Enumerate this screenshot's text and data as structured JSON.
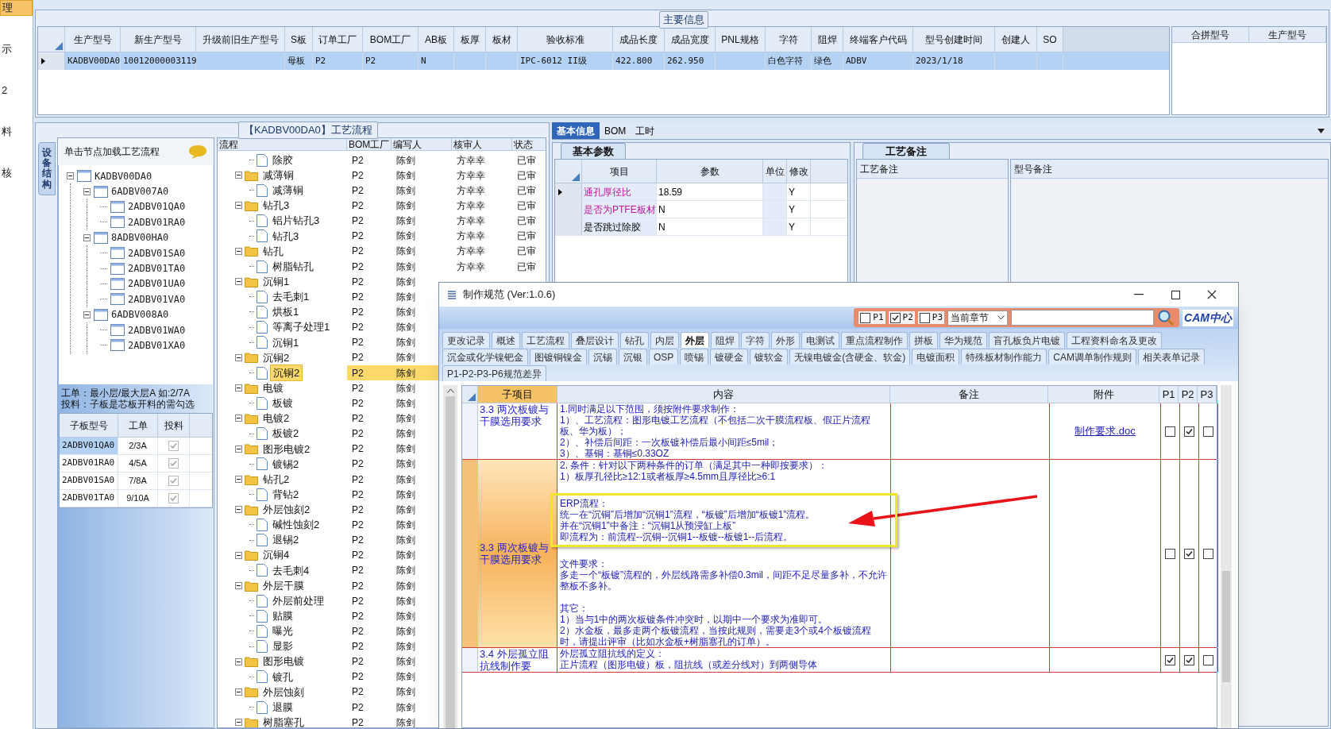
{
  "sidebar": {
    "items": [
      {
        "label": "理",
        "selected": true
      },
      {
        "label": "示",
        "selected": false
      },
      {
        "label": "2",
        "selected": false
      },
      {
        "label": "料",
        "selected": false
      },
      {
        "label": "核",
        "selected": false
      }
    ]
  },
  "main_info": {
    "title": "主要信息",
    "columns": [
      "生产型号",
      "新生产型号",
      "升级前旧生产型号",
      "S板",
      "订单工厂",
      "BOM工厂",
      "AB板",
      "板厚",
      "板材",
      "验收标准",
      "成品长度",
      "成品宽度",
      "PNL规格",
      "字符",
      "阻焊",
      "终端客户代码",
      "型号创建时间",
      "创建人",
      "SO"
    ],
    "rows": [
      {
        "selected": true,
        "cells": [
          "KADBV00DA0",
          "10012000003119",
          null,
          "母板",
          "P2",
          "P2",
          "N",
          null,
          null,
          "IPC-6012 II级",
          "422.800",
          "262.950",
          null,
          "白色字符",
          "绿色",
          "ADBV",
          "2023/1/18",
          null,
          null
        ]
      }
    ],
    "merge_columns": [
      "合拼型号",
      "生产型号"
    ]
  },
  "process": {
    "title": "【KADBV00DA0】工艺流程",
    "side_tab": "设备结构",
    "tree_hint": "单击节点加载工艺流程",
    "structure": [
      {
        "label": "KADBV00DA0",
        "expanded": true,
        "children": [
          {
            "label": "6ADBV007A0",
            "expanded": true,
            "children": [
              {
                "label": "2ADBV01QA0"
              },
              {
                "label": "2ADBV01RA0"
              }
            ]
          },
          {
            "label": "8ADBV00HA0",
            "expanded": true,
            "children": [
              {
                "label": "2ADBV01SA0"
              },
              {
                "label": "2ADBV01TA0"
              },
              {
                "label": "2ADBV01UA0"
              },
              {
                "label": "2ADBV01VA0"
              }
            ]
          },
          {
            "label": "6ADBV008A0",
            "expanded": true,
            "children": [
              {
                "label": "2ADBV01WA0"
              },
              {
                "label": "2ADBV01XA0"
              }
            ]
          }
        ]
      }
    ],
    "notes": [
      "工单：最小层/最大层A 如:2/7A",
      "投料：子板是芯板开料的需勾选"
    ],
    "boards": {
      "columns": [
        "子板型号",
        "工单",
        "投料"
      ],
      "rows": [
        {
          "cells": [
            "2ADBV01QA0",
            "2/3A"
          ],
          "feed": true,
          "selected": true
        },
        {
          "cells": [
            "2ADBV01RA0",
            "4/5A"
          ],
          "feed": true,
          "selected": false
        },
        {
          "cells": [
            "2ADBV01SA0",
            "7/8A"
          ],
          "feed": true,
          "selected": false
        },
        {
          "cells": [
            "2ADBV01TA0",
            "9/10A"
          ],
          "feed": true,
          "selected": false
        }
      ]
    },
    "flow": {
      "columns": [
        "流程",
        "BOM工厂",
        "编写人",
        "核审人",
        "状态"
      ],
      "rows": [
        {
          "kind": "file",
          "cells": [
            "除胶",
            "P2",
            "陈剑",
            "方幸幸",
            "已审"
          ],
          "selected": false
        },
        {
          "kind": "folder",
          "expanded": true,
          "cells": [
            "减薄铜",
            "P2",
            "陈剑",
            "方幸幸",
            "已审"
          ],
          "selected": false,
          "children": [
            {
              "kind": "file",
              "cells": [
                "减薄铜",
                "P2",
                "陈剑",
                "方幸幸",
                "已审"
              ],
              "selected": false
            }
          ]
        },
        {
          "kind": "folder",
          "expanded": true,
          "cells": [
            "钻孔3",
            "P2",
            "陈剑",
            "方幸幸",
            "已审"
          ],
          "selected": false,
          "children": [
            {
              "kind": "file",
              "cells": [
                "铝片钻孔3",
                "P2",
                "陈剑",
                "方幸幸",
                "已审"
              ],
              "selected": false
            },
            {
              "kind": "file",
              "cells": [
                "钻孔3",
                "P2",
                "陈剑",
                "方幸幸",
                "已审"
              ],
              "selected": false
            }
          ]
        },
        {
          "kind": "folder",
          "expanded": true,
          "cells": [
            "钻孔",
            "P2",
            "陈剑",
            "方幸幸",
            "已审"
          ],
          "selected": false,
          "children": [
            {
              "kind": "file",
              "cells": [
                "树脂钻孔",
                "P2",
                "陈剑",
                "方幸幸",
                "已审"
              ],
              "selected": false
            }
          ]
        },
        {
          "kind": "folder",
          "expanded": true,
          "cells": [
            "沉铜1",
            "P2",
            "陈剑"
          ],
          "selected": false,
          "children": [
            {
              "kind": "file",
              "cells": [
                "去毛刺1",
                "P2",
                "陈剑"
              ],
              "selected": false
            },
            {
              "kind": "file",
              "cells": [
                "烘板1",
                "P2",
                "陈剑"
              ],
              "selected": false
            },
            {
              "kind": "file",
              "cells": [
                "等离子处理1",
                "P2",
                "陈剑"
              ],
              "selected": false
            },
            {
              "kind": "file",
              "cells": [
                "沉铜1",
                "P2",
                "陈剑"
              ],
              "selected": false
            }
          ]
        },
        {
          "kind": "folder",
          "expanded": true,
          "cells": [
            "沉铜2",
            "P2",
            "陈剑"
          ],
          "selected": false,
          "children": [
            {
              "kind": "file",
              "cells": [
                "沉铜2",
                "P2",
                "陈剑"
              ],
              "selected": true
            }
          ]
        },
        {
          "kind": "folder",
          "expanded": true,
          "cells": [
            "电镀",
            "P2",
            "陈剑"
          ],
          "selected": false,
          "children": [
            {
              "kind": "file",
              "cells": [
                "板镀",
                "P2",
                "陈剑"
              ],
              "selected": false
            }
          ]
        },
        {
          "kind": "folder",
          "expanded": true,
          "cells": [
            "电镀2",
            "P2",
            "陈剑"
          ],
          "selected": false,
          "children": [
            {
              "kind": "file",
              "cells": [
                "板镀2",
                "P2",
                "陈剑"
              ],
              "selected": false
            }
          ]
        },
        {
          "kind": "folder",
          "expanded": true,
          "cells": [
            "图形电镀2",
            "P2",
            "陈剑"
          ],
          "selected": false,
          "children": [
            {
              "kind": "file",
              "cells": [
                "镀锡2",
                "P2",
                "陈剑"
              ],
              "selected": false
            }
          ]
        },
        {
          "kind": "folder",
          "expanded": true,
          "cells": [
            "钻孔2",
            "P2",
            "陈剑"
          ],
          "selected": false,
          "children": [
            {
              "kind": "file",
              "cells": [
                "背钻2",
                "P2",
                "陈剑"
              ],
              "selected": false
            }
          ]
        },
        {
          "kind": "folder",
          "expanded": true,
          "cells": [
            "外层蚀刻2",
            "P2",
            "陈剑"
          ],
          "selected": false,
          "children": [
            {
              "kind": "file",
              "cells": [
                "碱性蚀刻2",
                "P2",
                "陈剑"
              ],
              "selected": false
            },
            {
              "kind": "file",
              "cells": [
                "退锡2",
                "P2",
                "陈剑"
              ],
              "selected": false
            }
          ]
        },
        {
          "kind": "folder",
          "expanded": true,
          "cells": [
            "沉铜4",
            "P2",
            "陈剑"
          ],
          "selected": false,
          "children": [
            {
              "kind": "file",
              "cells": [
                "去毛刺4",
                "P2",
                "陈剑"
              ],
              "selected": false
            }
          ]
        },
        {
          "kind": "folder",
          "expanded": true,
          "cells": [
            "外层干膜",
            "P2",
            "陈剑"
          ],
          "selected": false,
          "children": [
            {
              "kind": "file",
              "cells": [
                "外层前处理",
                "P2",
                "陈剑"
              ],
              "selected": false
            },
            {
              "kind": "file",
              "cells": [
                "贴膜",
                "P2",
                "陈剑"
              ],
              "selected": false
            },
            {
              "kind": "file",
              "cells": [
                "曝光",
                "P2",
                "陈剑"
              ],
              "selected": false
            },
            {
              "kind": "file",
              "cells": [
                "显影",
                "P2",
                "陈剑"
              ],
              "selected": false
            }
          ]
        },
        {
          "kind": "folder",
          "expanded": true,
          "cells": [
            "图形电镀",
            "P2",
            "陈剑"
          ],
          "selected": false,
          "children": [
            {
              "kind": "file",
              "cells": [
                "镀孔",
                "P2",
                "陈剑"
              ],
              "selected": false
            }
          ]
        },
        {
          "kind": "folder",
          "expanded": true,
          "cells": [
            "外层蚀刻",
            "P2",
            "陈剑"
          ],
          "selected": false,
          "children": [
            {
              "kind": "file",
              "cells": [
                "退膜",
                "P2",
                "陈剑"
              ],
              "selected": false
            }
          ]
        },
        {
          "kind": "folder",
          "expanded": true,
          "cells": [
            "树脂塞孔",
            "P2",
            "陈剑"
          ],
          "selected": false
        }
      ]
    }
  },
  "detail": {
    "tabs": [
      {
        "label": "基本信息",
        "selected": true
      },
      {
        "label": "BOM",
        "selected": false
      },
      {
        "label": "工时",
        "selected": false
      }
    ],
    "params": {
      "title": "基本参数",
      "columns": [
        "项目",
        "参数",
        "单位",
        "修改"
      ],
      "rows": [
        {
          "cells": [
            "通孔厚径比",
            "18.59",
            null,
            "Y"
          ],
          "flagged": true,
          "selected": true
        },
        {
          "cells": [
            "是否为PTFE板材",
            "N",
            null,
            "Y"
          ],
          "flagged": true,
          "selected": false
        },
        {
          "cells": [
            "是否跳过除胶",
            "N",
            null,
            "Y"
          ],
          "flagged": false,
          "selected": false
        }
      ]
    },
    "remarks": {
      "title": "工艺备注",
      "columns": [
        "工艺备注",
        "型号备注"
      ]
    }
  },
  "dialog": {
    "title": "制作规范 (Ver:1.0.6)",
    "filters": [
      {
        "label": "P1",
        "checked": false
      },
      {
        "label": "P2",
        "checked": true
      },
      {
        "label": "P3",
        "checked": false
      }
    ],
    "scope": "当前章节",
    "logo": "CAM中心",
    "tab_rows": [
      [
        {
          "label": "更改记录",
          "selected": false
        },
        {
          "label": "概述",
          "selected": false
        },
        {
          "label": "工艺流程",
          "selected": false
        },
        {
          "label": "叠层设计",
          "selected": false
        },
        {
          "label": "钻孔",
          "selected": false
        },
        {
          "label": "内层",
          "selected": false
        },
        {
          "label": "外层",
          "selected": true
        },
        {
          "label": "阻焊",
          "selected": false
        },
        {
          "label": "字符",
          "selected": false
        },
        {
          "label": "外形",
          "selected": false
        },
        {
          "label": "电测试",
          "selected": false
        },
        {
          "label": "重点流程制作",
          "selected": false
        },
        {
          "label": "拼板",
          "selected": false
        },
        {
          "label": "华为规范",
          "selected": false
        },
        {
          "label": "盲孔板负片电镀",
          "selected": false
        },
        {
          "label": "工程资料命名及更改",
          "selected": false
        }
      ],
      [
        {
          "label": "沉金或化学镍钯金",
          "selected": false
        },
        {
          "label": "图镀铜镍金",
          "selected": false
        },
        {
          "label": "沉锡",
          "selected": false
        },
        {
          "label": "沉银",
          "selected": false
        },
        {
          "label": "OSP",
          "selected": false
        },
        {
          "label": "喷锡",
          "selected": false
        },
        {
          "label": "镀硬金",
          "selected": false
        },
        {
          "label": "镀软金",
          "selected": false
        },
        {
          "label": "无镍电镀金(含硬金、软金)",
          "selected": false
        },
        {
          "label": "电镀面积",
          "selected": false
        },
        {
          "label": "特殊板材制作能力",
          "selected": false
        },
        {
          "label": "CAM调单制作规则",
          "selected": false
        },
        {
          "label": "相关表单记录",
          "selected": false
        }
      ],
      [
        {
          "label": "P1-P2-P3-P6规范差异",
          "selected": false
        }
      ]
    ],
    "grid": {
      "columns": [
        "子项目",
        "内容",
        "备注",
        "附件",
        "P1",
        "P2",
        "P3"
      ],
      "rows": [
        {
          "item": "3.3 两次板镀与干膜选用要求",
          "selected": false,
          "content": [
            {
              "lines": [
                "1.同时满足以下范围，须按附件要求制作：",
                "1）、工艺流程：图形电镀工艺流程（不包括二次干膜流程板、假正片流程板、华为板）；",
                "2）、补偿后间距：一次板镀补偿后最小间距≤5mil；",
                "3）、基铜：基铜≤0.33OZ"
              ],
              "highlighted": false
            }
          ],
          "attachment": "制作要求.doc",
          "p1": false,
          "p2": true,
          "p3": false
        },
        {
          "item": "3.3 两次板镀与干膜选用要求",
          "selected": true,
          "content": [
            {
              "lines": [
                "2. 条件：针对以下两种条件的订单（满足其中一种即按要求）：",
                "1）板厚孔径比≥12:1或者板厚≥4.5mm且厚径比≥6:1"
              ],
              "highlighted": false
            },
            {
              "lines": [
                "ERP流程：",
                "统一在“沉铜”后增加“沉铜1”流程，“板镀”后增加“板镀1”流程。",
                "并在“沉铜1”中备注：“沉铜1从预浸缸上板”",
                "即流程为：前流程--沉铜--沉铜1--板镀--板镀1--后流程。"
              ],
              "highlighted": true
            },
            {
              "lines": [
                "文件要求：",
                "多走一个“板镀”流程的，外层线路需多补偿0.3mil，间距不足尽量多补，不允许整板不多补。"
              ],
              "highlighted": false
            },
            {
              "lines": [
                "其它：",
                "1）当与1中的两次板镀条件冲突时，以期中一个要求为准即可。",
                "2）水金板，最多走两个板镀流程，当按此规则，需要走3个或4个板镀流程时，请提出评审（比如水金板+树脂塞孔的订单）。"
              ],
              "highlighted": false
            }
          ],
          "p1": false,
          "p2": true,
          "p3": false
        },
        {
          "item": "3.4 外层孤立阻抗线制作要",
          "selected": false,
          "content": [
            {
              "lines": [
                "外层孤立阻抗线的定义：",
                "正片流程（图形电镀）板，阻抗线（或差分线对）到两侧导体"
              ],
              "highlighted": false
            }
          ],
          "p1": true,
          "p2": true,
          "p3": false
        }
      ]
    }
  }
}
